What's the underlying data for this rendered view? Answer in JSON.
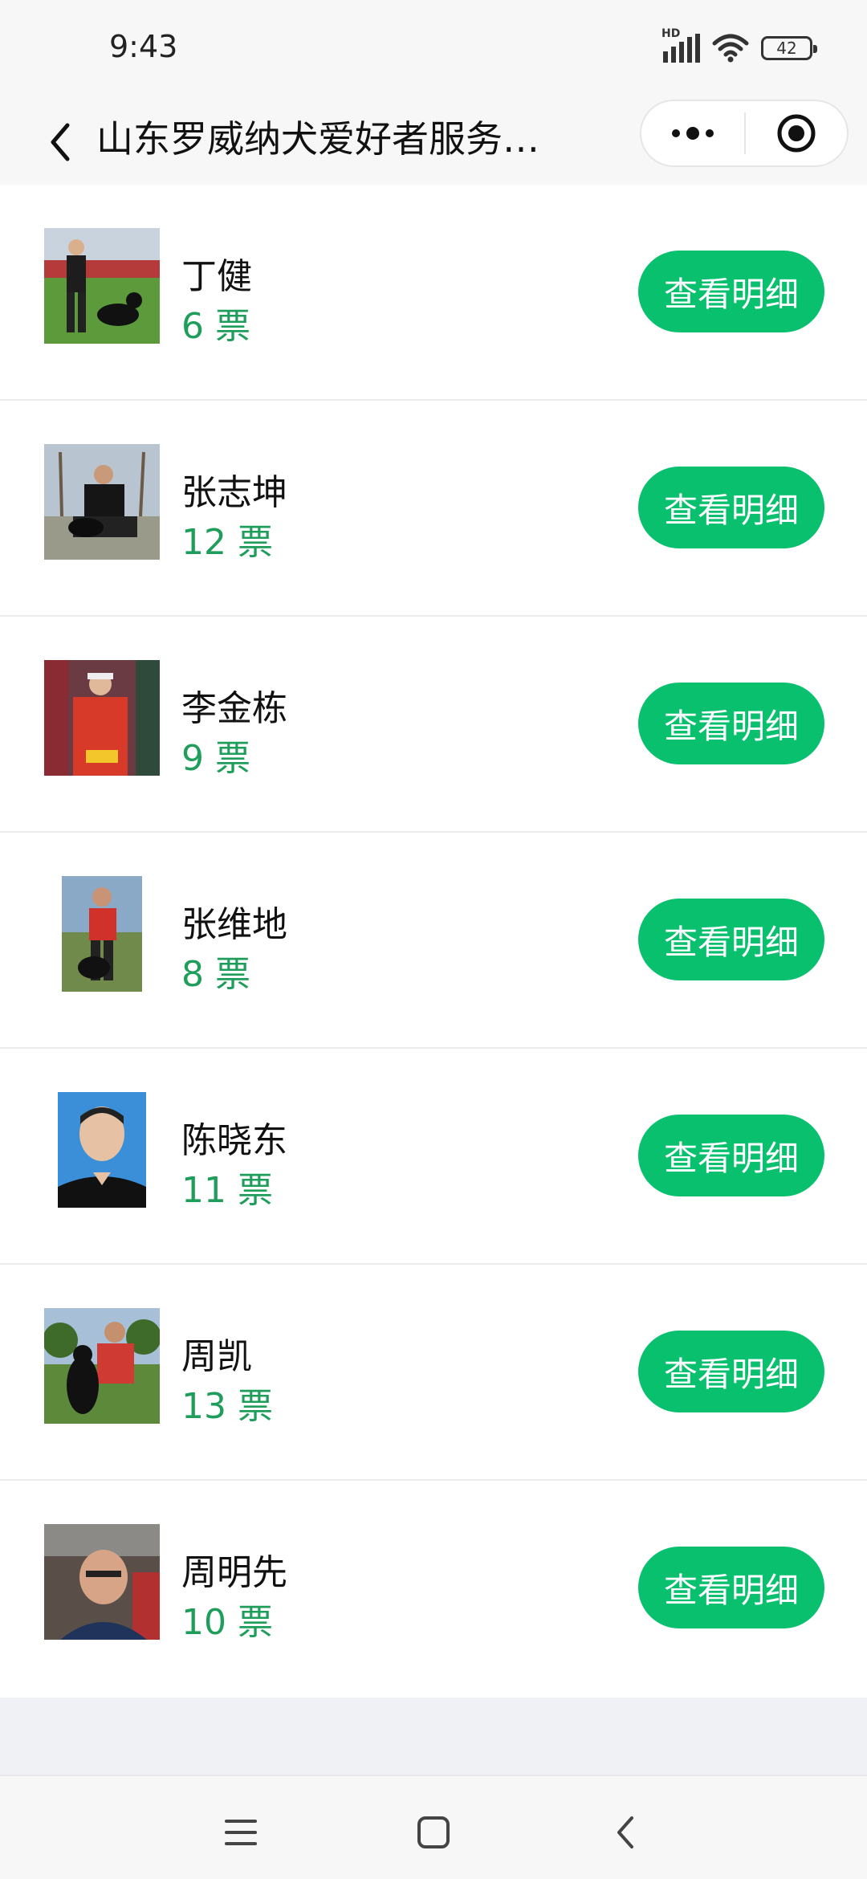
{
  "status_bar": {
    "time": "9:43",
    "network": "HD",
    "battery": "42"
  },
  "nav": {
    "title": "山东罗威纳犬爱好者服务…"
  },
  "entries": [
    {
      "name": "丁健",
      "votes": "6 票",
      "button": "查看明细"
    },
    {
      "name": "张志坤",
      "votes": "12 票",
      "button": "查看明细"
    },
    {
      "name": "李金栋",
      "votes": "9 票",
      "button": "查看明细"
    },
    {
      "name": "张维地",
      "votes": "8 票",
      "button": "查看明细"
    },
    {
      "name": "陈晓东",
      "votes": "11 票",
      "button": "查看明细"
    },
    {
      "name": "周凯",
      "votes": "13 票",
      "button": "查看明细"
    },
    {
      "name": "周明先",
      "votes": "10 票",
      "button": "查看明细"
    }
  ],
  "colors": {
    "accent": "#08c06d",
    "votes": "#1e9e5a",
    "background": "#f0f1f5"
  },
  "icons": [
    "back-arrow-icon",
    "more-dots-icon",
    "close-target-icon",
    "menu-icon",
    "home-icon",
    "back-icon"
  ]
}
